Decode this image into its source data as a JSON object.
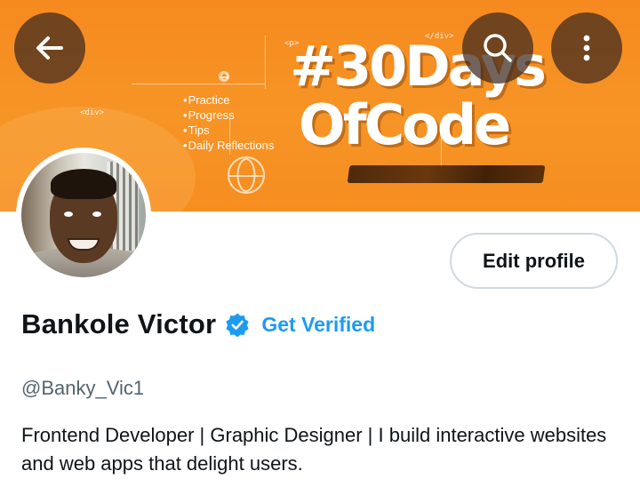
{
  "header": {
    "back_icon": "arrow-left-icon",
    "search_icon": "search-icon",
    "more_icon": "more-vertical-icon"
  },
  "banner": {
    "code_tags": [
      "<div>",
      "</div>",
      "<p>"
    ],
    "list_items": [
      "Practice",
      "Progress",
      "Tips",
      "Daily Reflections"
    ],
    "hashtag_line1": "#30Days",
    "hashtag_line2": "OfCode",
    "color": "#f68a1f"
  },
  "profile": {
    "edit_profile_label": "Edit profile",
    "name": "Bankole Victor",
    "verified_icon": "verified-badge-icon",
    "get_verified_label": "Get Verified",
    "handle": "@Banky_Vic1",
    "bio": "Frontend Developer | Graphic Designer | I build interactive websites and web apps that delight users."
  },
  "colors": {
    "accent": "#1d9bf0",
    "text_primary": "#0f1419",
    "text_secondary": "#536471"
  }
}
